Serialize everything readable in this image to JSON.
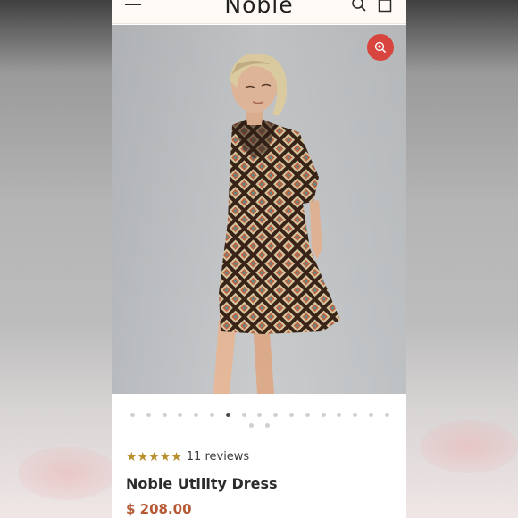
{
  "header": {
    "brand": "Noble",
    "menu_icon": "hamburger-menu-icon",
    "search_icon": "search-icon",
    "cart_icon": "shopping-bag-icon"
  },
  "gallery": {
    "zoom_icon": "zoom-in-icon",
    "zoom_color": "#d8453f",
    "dot_count": 19,
    "active_index": 6
  },
  "product": {
    "stars": "★★★★★",
    "rating": 5,
    "reviews": "11 reviews",
    "title": "Noble Utility Dress",
    "price": "$ 208.00",
    "star_color": "#b8902e",
    "price_color": "#b65a36"
  }
}
